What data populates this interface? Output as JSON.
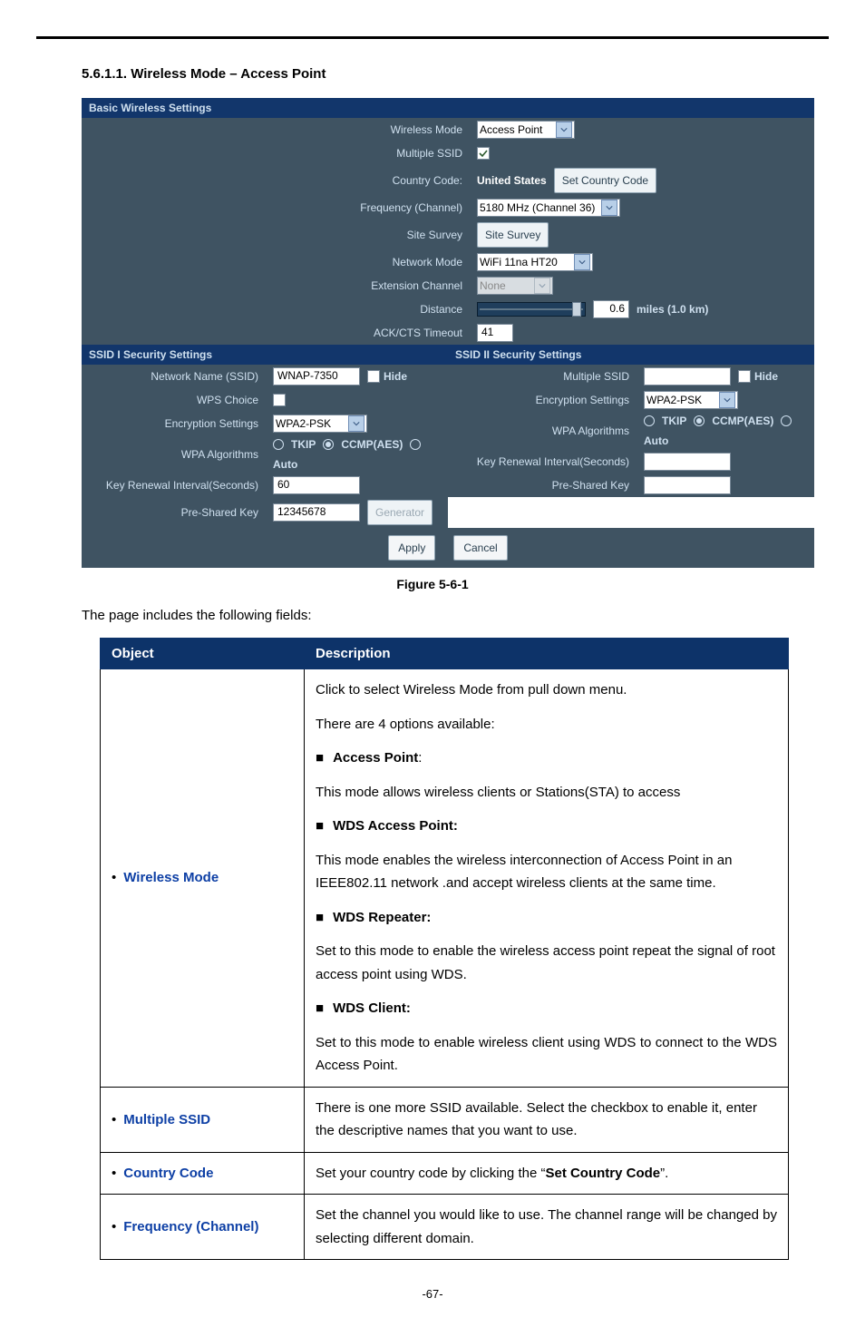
{
  "section": {
    "number": "5.6.1.1.",
    "title": "Wireless Mode – Access Point"
  },
  "panel": {
    "basic_header": "Basic Wireless Settings",
    "labels": {
      "wireless_mode": "Wireless Mode",
      "multiple_ssid": "Multiple SSID",
      "country_code": "Country Code:",
      "frequency": "Frequency (Channel)",
      "site_survey": "Site Survey",
      "network_mode": "Network Mode",
      "ext_channel": "Extension Channel",
      "distance": "Distance",
      "ack": "ACK/CTS Timeout"
    },
    "values": {
      "wireless_mode": "Access Point",
      "multiple_ssid_checked": true,
      "country": "United States",
      "set_country_btn": "Set Country Code",
      "frequency": "5180 MHz (Channel 36)",
      "site_survey_btn": "Site Survey",
      "network_mode": "WiFi 11na HT20",
      "ext_channel": "None",
      "distance_value": "0.6",
      "distance_units": "miles (1.0 km)",
      "ack_value": "41"
    },
    "ssid1": {
      "header": "SSID I Security Settings",
      "labels": {
        "ssid": "Network Name (SSID)",
        "wps": "WPS Choice",
        "enc": "Encryption Settings",
        "alg": "WPA Algorithms",
        "renew": "Key Renewal Interval(Seconds)",
        "psk": "Pre-Shared Key"
      },
      "values": {
        "ssid": "WNAP-7350",
        "hide": "Hide",
        "wps_checked": false,
        "enc": "WPA2-PSK",
        "alg_tkip": "TKIP",
        "alg_ccmp": "CCMP(AES)",
        "alg_auto": "Auto",
        "alg_selected": "ccmp",
        "renew": "60",
        "psk": "12345678",
        "generator_btn": "Generator"
      }
    },
    "ssid2": {
      "header": "SSID II Security Settings",
      "labels": {
        "multiple_ssid": "Multiple SSID",
        "enc": "Encryption Settings",
        "alg": "WPA Algorithms",
        "renew": "Key Renewal Interval(Seconds)",
        "psk": "Pre-Shared Key"
      },
      "values": {
        "ssid": "",
        "hide": "Hide",
        "enc": "WPA2-PSK",
        "alg_tkip": "TKIP",
        "alg_ccmp": "CCMP(AES)",
        "alg_auto": "Auto",
        "alg_selected": "ccmp",
        "renew": "",
        "psk": ""
      }
    },
    "apply": "Apply",
    "cancel": "Cancel"
  },
  "figure_caption": "Figure 5-6-1",
  "intro": "The page includes the following fields:",
  "table": {
    "header_object": "Object",
    "header_description": "Description",
    "rows": {
      "wireless_mode": {
        "label": "Wireless Mode",
        "d1": "Click to select Wireless Mode from pull down menu.",
        "d2": "There are 4 options available:",
        "opt1": "Access Point",
        "opt1_colon": ":",
        "opt1_desc": "This mode allows wireless clients or Stations(STA) to access",
        "opt2": "WDS Access Point:",
        "opt2_desc": "This mode enables the wireless interconnection of Access Point in an IEEE802.11 network .and accept wireless clients at the same time.",
        "opt3": "WDS Repeater:",
        "opt3_desc": "Set to this mode to enable the wireless access point repeat the signal of root access point using WDS.",
        "opt4": "WDS Client:",
        "opt4_desc": "Set to this mode to enable wireless client using WDS to connect to the WDS Access Point."
      },
      "multiple_ssid": {
        "label": "Multiple SSID",
        "desc": "There is one more SSID available. Select the checkbox to enable it, enter the descriptive names that you want to use."
      },
      "country_code": {
        "label": "Country Code",
        "desc_pre": "Set your country code by clicking the “",
        "desc_bold": "Set Country Code",
        "desc_post": "”."
      },
      "frequency": {
        "label": "Frequency (Channel)",
        "desc": "Set the channel you would like to use. The channel range will be changed by selecting different domain."
      }
    }
  },
  "page_number": "-67-"
}
